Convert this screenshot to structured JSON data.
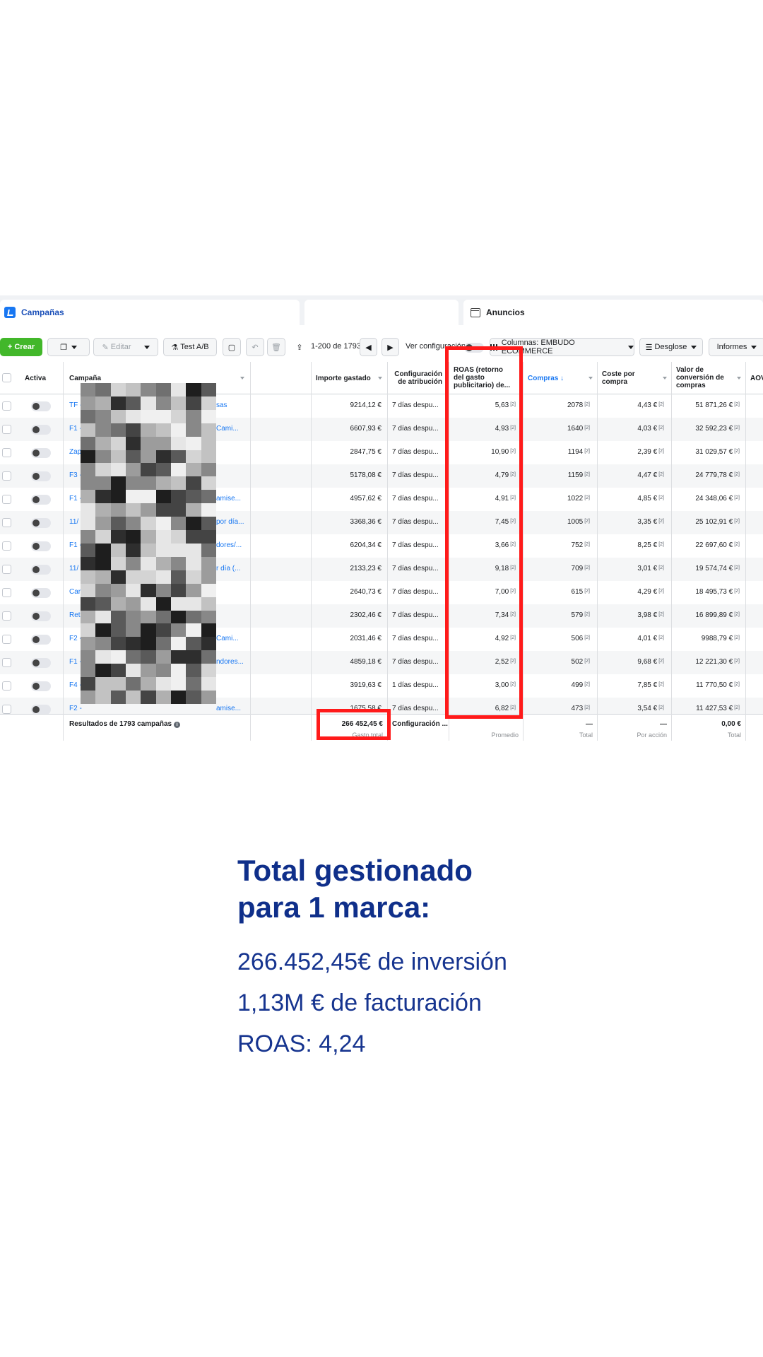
{
  "tabs": {
    "campaigns": "Campañas",
    "ads": "Anuncios"
  },
  "toolbar": {
    "create": "+ Crear",
    "edit": "Editar",
    "ab_test": "Test A/B",
    "pagination": "1-200 de 1793",
    "view_config": "Ver configuración",
    "columns": "Columnas: EMBUDO ECOMMERCE",
    "breakdown": "Desglose",
    "reports": "Informes"
  },
  "table": {
    "headers": {
      "active": "Activa",
      "campaign": "Campaña",
      "spent": "Importe gastado",
      "attribution": [
        "Configuración",
        "de atribución"
      ],
      "roas": [
        "ROAS (retorno",
        "del gasto",
        "publicitario) de..."
      ],
      "purchases": "Compras ↓",
      "cost_per_purchase": [
        "Coste por",
        "compra"
      ],
      "conversion_value": [
        "Valor de",
        "conversión de",
        "compras"
      ],
      "aov": "AOV"
    },
    "rows": [
      {
        "prefix": "TF -",
        "suffix": "sas",
        "spent": "9214,12 €",
        "attr": "7 días despu...",
        "roas": "5,63",
        "purchases": "2078",
        "cpp": "4,43 €",
        "value": "51 871,26 €"
      },
      {
        "prefix": "F1 -",
        "suffix": "Cami...",
        "spent": "6607,93 €",
        "attr": "7 días despu...",
        "roas": "4,93",
        "purchases": "1640",
        "cpp": "4,03 €",
        "value": "32 592,23 €"
      },
      {
        "prefix": "Zap",
        "suffix": "",
        "spent": "2847,75 €",
        "attr": "7 días despu...",
        "roas": "10,90",
        "purchases": "1194",
        "cpp": "2,39 €",
        "value": "31 029,57 €"
      },
      {
        "prefix": "F3 -",
        "suffix": "",
        "spent": "5178,08 €",
        "attr": "7 días despu...",
        "roas": "4,79",
        "purchases": "1159",
        "cpp": "4,47 €",
        "value": "24 779,78 €"
      },
      {
        "prefix": "F1 -",
        "suffix": "amise...",
        "spent": "4957,62 €",
        "attr": "7 días despu...",
        "roas": "4,91",
        "purchases": "1022",
        "cpp": "4,85 €",
        "value": "24 348,06 €"
      },
      {
        "prefix": "11/",
        "suffix": "por día...",
        "spent": "3368,36 €",
        "attr": "7 días despu...",
        "roas": "7,45",
        "purchases": "1005",
        "cpp": "3,35 €",
        "value": "25 102,91 €"
      },
      {
        "prefix": "F1 -",
        "suffix": "dores/...",
        "spent": "6204,34 €",
        "attr": "7 días despu...",
        "roas": "3,66",
        "purchases": "752",
        "cpp": "8,25 €",
        "value": "22 697,60 €"
      },
      {
        "prefix": "11/",
        "suffix": "r día (...",
        "spent": "2133,23 €",
        "attr": "7 días despu...",
        "roas": "9,18",
        "purchases": "709",
        "cpp": "3,01 €",
        "value": "19 574,74 €"
      },
      {
        "prefix": "Car",
        "suffix": "",
        "spent": "2640,73 €",
        "attr": "7 días despu...",
        "roas": "7,00",
        "purchases": "615",
        "cpp": "4,29 €",
        "value": "18 495,73 €"
      },
      {
        "prefix": "Ret",
        "suffix": "",
        "spent": "2302,46 €",
        "attr": "7 días despu...",
        "roas": "7,34",
        "purchases": "579",
        "cpp": "3,98 €",
        "value": "16 899,89 €"
      },
      {
        "prefix": "F2 -",
        "suffix": "Cami...",
        "spent": "2031,46 €",
        "attr": "7 días despu...",
        "roas": "4,92",
        "purchases": "506",
        "cpp": "4,01 €",
        "value": "9988,79 €"
      },
      {
        "prefix": "F1 -",
        "suffix": "ndores...",
        "spent": "4859,18 €",
        "attr": "7 días despu...",
        "roas": "2,52",
        "purchases": "502",
        "cpp": "9,68 €",
        "value": "12 221,30 €"
      },
      {
        "prefix": "F4 -",
        "suffix": "",
        "spent": "3919,63 €",
        "attr": "1 días despu...",
        "roas": "3,00",
        "purchases": "499",
        "cpp": "7,85 €",
        "value": "11 770,50 €"
      },
      {
        "prefix": "F2 -",
        "suffix": "amise...",
        "spent": "1675,58 €",
        "attr": "7 días despu...",
        "roas": "6,82",
        "purchases": "473",
        "cpp": "3,54 €",
        "value": "11 427,53 €"
      }
    ],
    "footer": {
      "results": "Resultados de 1793 campañas",
      "total_spent": "266 452,45 €",
      "total_spent_sub": "Gasto total",
      "attribution": "Configuración ...",
      "roas_sub": "Promedio",
      "purchases": "—",
      "purchases_sub": "Total",
      "cpp": "—",
      "cpp_sub": "Por acción",
      "value": "0,00 €",
      "value_sub": "Total"
    }
  },
  "colors": {
    "highlight": "#ff1a1a",
    "headline": "#0f2f8a",
    "link": "#1877f2",
    "create_button": "#42b72a"
  },
  "summary": {
    "title_line1": "Total gestionado",
    "title_line2": "para 1 marca:",
    "investment": "266.452,45€ de inversión",
    "revenue": "1,13M € de facturación",
    "roas": "ROAS: 4,24"
  }
}
